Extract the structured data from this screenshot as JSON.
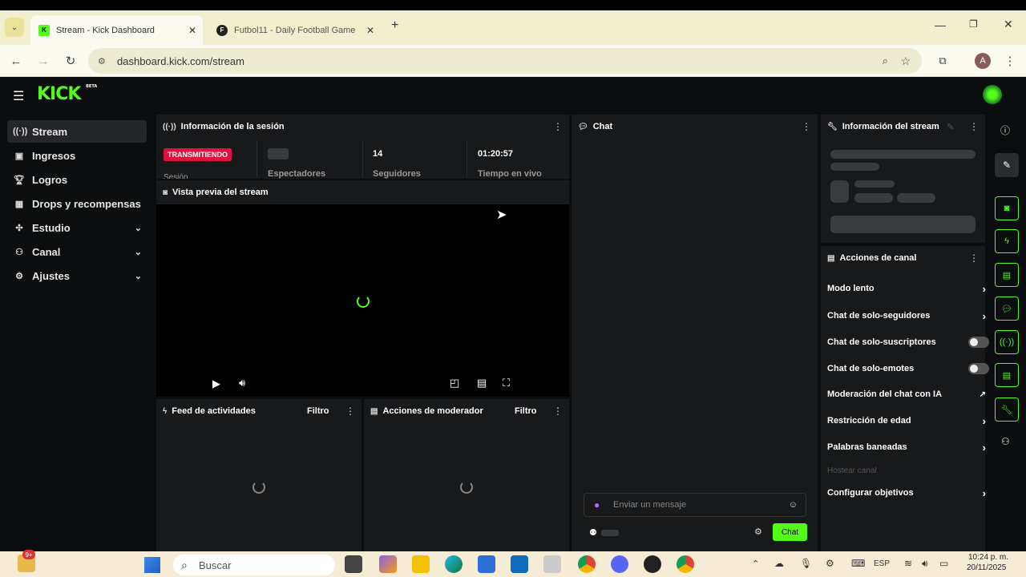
{
  "browser": {
    "tabs": [
      {
        "title": "Stream - Kick Dashboard",
        "active": true
      },
      {
        "title": "Futbol11 - Daily Football Game",
        "active": false
      }
    ],
    "url": "dashboard.kick.com/stream",
    "profile_initial": "A"
  },
  "app": {
    "logo": "KICK",
    "logo_badge": "BETA",
    "sidebar": [
      {
        "label": "Stream",
        "icon": "broadcast-icon",
        "active": true
      },
      {
        "label": "Ingresos",
        "icon": "money-icon"
      },
      {
        "label": "Logros",
        "icon": "trophy-icon"
      },
      {
        "label": "Drops y recompensas",
        "icon": "gift-icon"
      },
      {
        "label": "Estudio",
        "icon": "studio-icon",
        "expandable": true
      },
      {
        "label": "Canal",
        "icon": "channel-icon",
        "expandable": true
      },
      {
        "label": "Ajustes",
        "icon": "gear-icon",
        "expandable": true
      }
    ],
    "session": {
      "title": "Información de la sesión",
      "status_badge": "TRANSMITIENDO",
      "session_label": "Sesión",
      "viewers_label": "Espectadores",
      "followers_value": "14",
      "followers_label": "Seguidores",
      "time_value": "01:20:57",
      "time_label": "Tiempo en vivo"
    },
    "preview": {
      "title": "Vista previa del stream"
    },
    "activity": {
      "title": "Feed de actividades",
      "filter": "Filtro"
    },
    "modactions": {
      "title": "Acciones de moderador",
      "filter": "Filtro"
    },
    "chat": {
      "title": "Chat",
      "placeholder": "Enviar un mensaje",
      "send_label": "Chat"
    },
    "stream_info": {
      "title": "Información del stream"
    },
    "channel_actions": {
      "title": "Acciones de canal",
      "items": [
        {
          "label": "Modo lento",
          "control": "arrow"
        },
        {
          "label": "Chat de solo-seguidores",
          "control": "arrow"
        },
        {
          "label": "Chat de solo-suscriptores",
          "control": "toggle"
        },
        {
          "label": "Chat de solo-emotes",
          "control": "toggle"
        },
        {
          "label": "Moderación del chat con IA",
          "control": "external"
        },
        {
          "label": "Restricción de edad",
          "control": "arrow"
        },
        {
          "label": "Palabras baneadas",
          "control": "arrow"
        },
        {
          "label": "Hostear canal",
          "control": "disabled"
        },
        {
          "label": "Configurar objetivos",
          "control": "arrow"
        }
      ]
    }
  },
  "taskbar": {
    "search_placeholder": "Buscar",
    "lang": "ESP",
    "time": "10:24 p. m.",
    "date": "20/11/2025",
    "badge": "9+"
  },
  "colors": {
    "brand": "#53fc18",
    "live": "#e0113d"
  }
}
